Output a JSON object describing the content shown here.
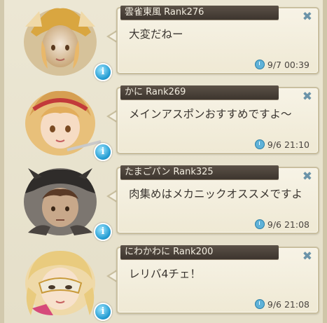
{
  "messages": [
    {
      "name": "雲雀東風 Rank276",
      "text": "大変だねー",
      "time": "9/7 00:39",
      "avatar_icon": "helmet-knight-avatar"
    },
    {
      "name": "かに Rank269",
      "text": "メインアスポンおすすめですよ～",
      "time": "9/6 21:10",
      "avatar_icon": "blonde-girl-hairband-avatar"
    },
    {
      "name": "たまごパン Rank325",
      "text": "肉集めはメカニックオススメですよ",
      "time": "9/6 21:08",
      "avatar_icon": "dark-armor-warrior-avatar"
    },
    {
      "name": "にわかわに Rank200",
      "text": "レリバ4チェ！",
      "time": "9/6 21:08",
      "avatar_icon": "masked-blonde-avatar"
    }
  ],
  "info_glyph": "i",
  "close_glyph": "✖",
  "colors": {
    "name_bar": "#4a4038",
    "bubble_bg": "#f3eedd",
    "info_blue": "#1d97cf",
    "close_blue": "#6b93a8"
  }
}
